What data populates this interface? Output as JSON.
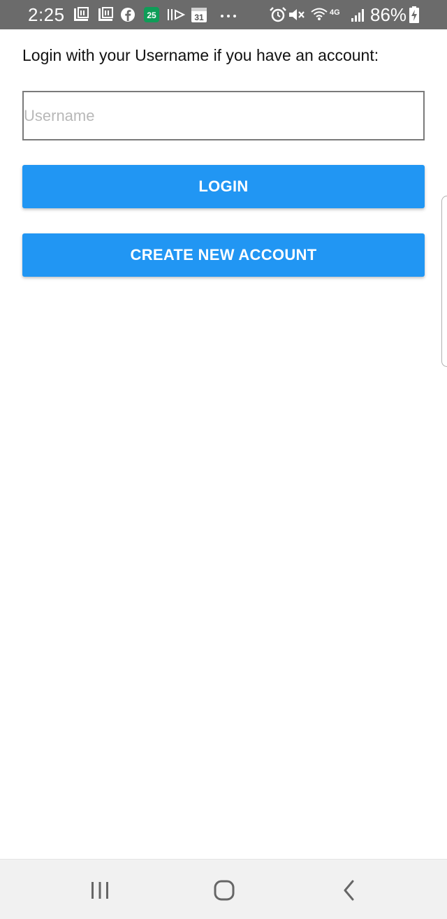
{
  "status_bar": {
    "time": "2:25",
    "battery_percent": "86%",
    "calendar_badge": "25",
    "calendar_day": "31",
    "network_label": "4G",
    "overflow": "···",
    "icons": [
      "gallery-icon",
      "gallery-icon",
      "facebook-icon",
      "calendar-badge-icon",
      "media-icon",
      "calendar-icon",
      "more-dots-icon",
      "alarm-icon",
      "mute-icon",
      "wifi-icon",
      "signal-4g-icon",
      "signal-bars-icon",
      "battery-charging-icon"
    ]
  },
  "login": {
    "prompt": "Login with your Username if you have an account:",
    "username_placeholder": "Username",
    "username_value": "",
    "login_button": "LOGIN",
    "create_account_button": "CREATE NEW ACCOUNT"
  },
  "nav_bar": {
    "icons": [
      "recent-apps-icon",
      "home-icon",
      "back-icon"
    ]
  },
  "colors": {
    "status_bar_bg": "#6b6b6b",
    "button_blue": "#2196f3",
    "button_text": "#ffffff",
    "nav_bar_bg": "#f1f1f1"
  }
}
